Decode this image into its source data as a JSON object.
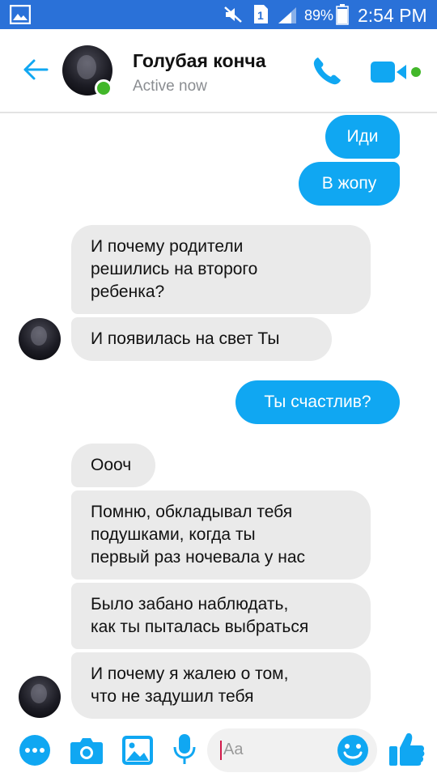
{
  "status_bar": {
    "battery": "89%",
    "time": "2:54 PM",
    "icons": [
      "gallery-icon",
      "mute-icon",
      "sim-icon",
      "signal-icon",
      "battery-icon"
    ],
    "background_color": "#2a71d8"
  },
  "header": {
    "contact_name": "Голубая конча",
    "status": "Active now",
    "accent_color": "#10a7f2",
    "online_color": "#42b72a"
  },
  "messages": [
    {
      "direction": "outgoing",
      "text": "Иди"
    },
    {
      "direction": "outgoing",
      "text": "В жопу"
    },
    {
      "direction": "incoming",
      "text": "И почему родители\nрешились на второго\nребенка?"
    },
    {
      "direction": "incoming",
      "text": "И появилась на свет Ты"
    },
    {
      "direction": "outgoing",
      "text": "Ты счастлив?"
    },
    {
      "direction": "incoming",
      "text": "Оооч"
    },
    {
      "direction": "incoming",
      "text": "Помню, обкладывал тебя\nподушками, когда ты\nпервый раз ночевала у нас"
    },
    {
      "direction": "incoming",
      "text": "Было забано наблюдать,\nкак ты пыталась выбраться"
    },
    {
      "direction": "incoming",
      "text": "И почему я жалею о том,\nчто не задушил тебя"
    }
  ],
  "composer": {
    "placeholder": "Aa",
    "icons": [
      "more-icon",
      "camera-icon",
      "image-icon",
      "microphone-icon",
      "emoji-icon",
      "like-icon"
    ]
  }
}
